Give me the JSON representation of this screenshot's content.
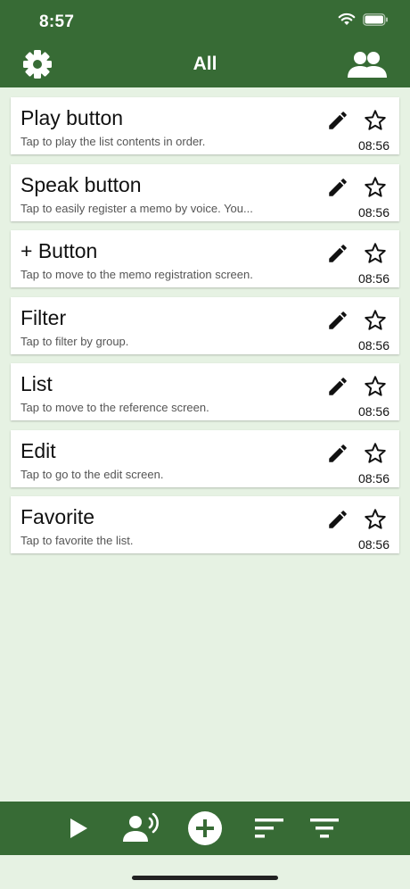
{
  "status": {
    "time": "8:57"
  },
  "nav": {
    "title": "All",
    "left_icon": "gear-icon",
    "right_icon": "people-icon"
  },
  "items": [
    {
      "title": "Play button",
      "subtitle": "Tap to play the list contents in order.",
      "time": "08:56"
    },
    {
      "title": "Speak button",
      "subtitle": "Tap to easily register a memo by voice. You...",
      "time": "08:56"
    },
    {
      "title": "+ Button",
      "subtitle": "Tap to move to the memo registration screen.",
      "time": "08:56"
    },
    {
      "title": "Filter",
      "subtitle": "Tap to filter by group.",
      "time": "08:56"
    },
    {
      "title": "List",
      "subtitle": "Tap to move to the reference screen.",
      "time": "08:56"
    },
    {
      "title": "Edit",
      "subtitle": "Tap to go to the edit screen.",
      "time": "08:56"
    },
    {
      "title": "Favorite",
      "subtitle": "Tap to favorite the list.",
      "time": "08:56"
    }
  ],
  "toolbar": {
    "icons": [
      "play-icon",
      "voice-icon",
      "add-icon",
      "sort-icon",
      "filter-icon"
    ]
  },
  "colors": {
    "primary": "#376b35",
    "background": "#e6f2e3"
  }
}
